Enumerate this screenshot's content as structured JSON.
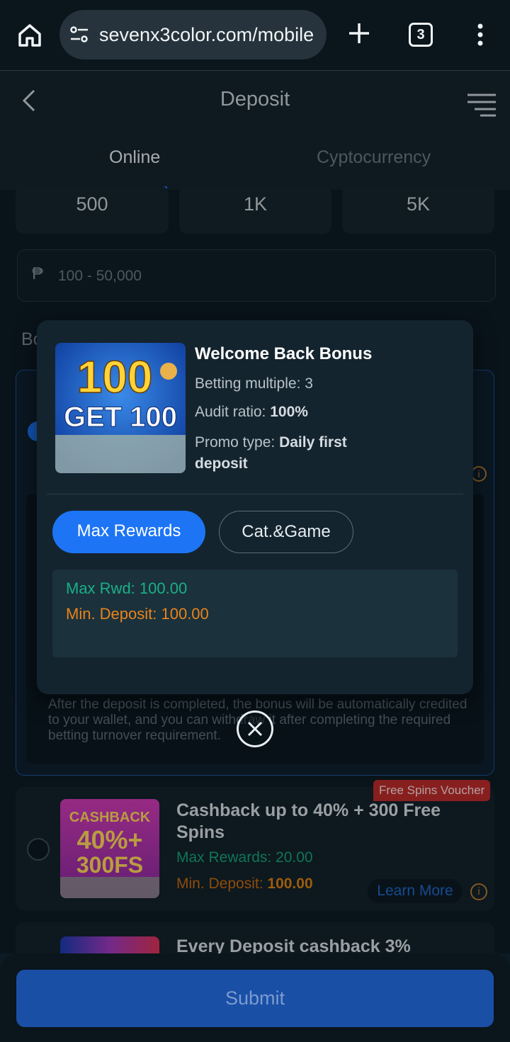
{
  "browser": {
    "url": "sevenx3color.com/mobile",
    "tab_count": "3"
  },
  "header": {
    "title": "Deposit",
    "tabs": [
      {
        "label": "Online",
        "active": true
      },
      {
        "label": "Cyptocurrency",
        "active": false
      }
    ]
  },
  "amount_chips": [
    "500",
    "1K",
    "5K"
  ],
  "amount_input": {
    "currency": "₱",
    "placeholder": "100 - 50,000"
  },
  "bonus_section_label": "Bo",
  "selected_bonus_note": "After the deposit is completed, the bonus will be automatically credited to your wallet, and you can withdraw it after completing the required betting turnover requirement.",
  "modal": {
    "image_text_1": "100",
    "image_text_2": "GET 100",
    "title": "Welcome Back Bonus",
    "betting_multiple_label": "Betting multiple: ",
    "betting_multiple_value": "3",
    "audit_ratio_label": "Audit ratio: ",
    "audit_ratio_value": "100%",
    "promo_type_label": "Promo type: ",
    "promo_type_value": "Daily first deposit",
    "tabs": [
      {
        "label": "Max Rewards",
        "active": true
      },
      {
        "label": "Cat.&Game",
        "active": false
      }
    ],
    "max_rwd": "Max Rwd: 100.00",
    "min_deposit": "Min. Deposit: 100.00"
  },
  "bonus_cards": [
    {
      "badge": "Free Spins Voucher",
      "image_text_1": "CASHBACK",
      "image_text_2": "40%+",
      "image_text_3": "300FS",
      "title": "Cashback up to 40% + 300 Free Spins",
      "max_rewards": "Max Rewards: 20.00",
      "min_deposit_label": "Min. Deposit: ",
      "min_deposit_value": "100.00",
      "learn_more": "Learn More"
    },
    {
      "title": "Every Deposit cashback 3%"
    }
  ],
  "submit_label": "Submit",
  "colors": {
    "accent": "#1d75f5",
    "green": "#1ab086",
    "orange": "#e9841a",
    "badge_red": "#bd2b2b"
  }
}
